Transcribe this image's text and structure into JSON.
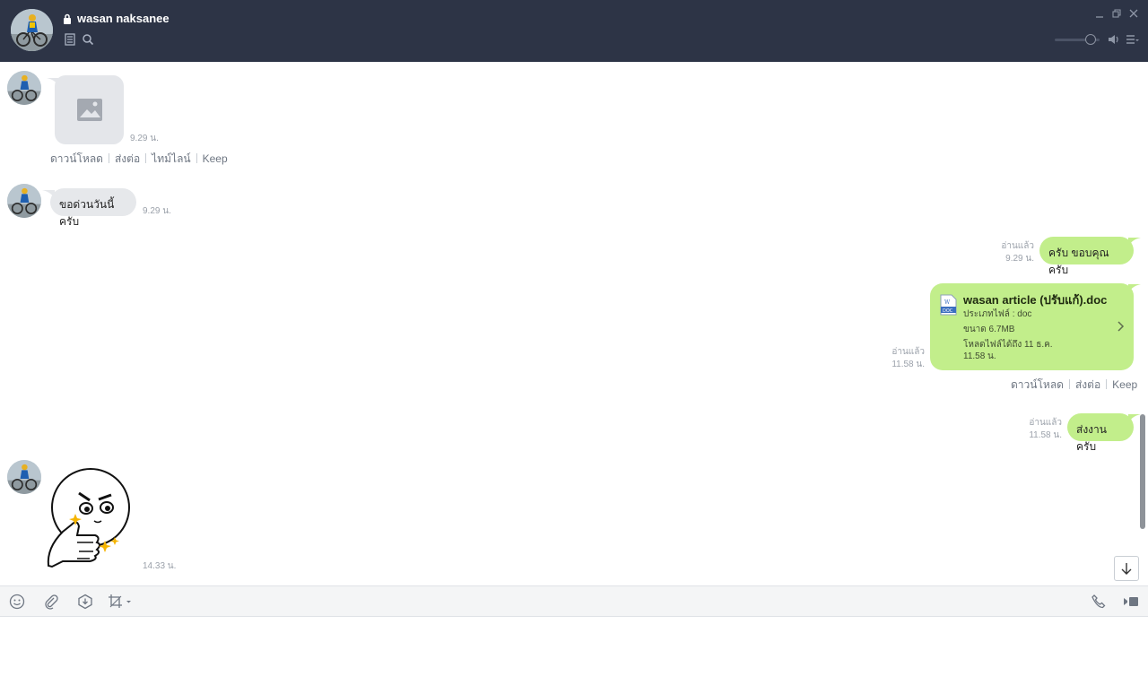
{
  "header": {
    "contact_name": "wasan naksanee",
    "icons": [
      "lock-icon",
      "notes-icon",
      "search-icon",
      "minimize-icon",
      "restore-icon",
      "close-icon",
      "volume-icon",
      "menu-icon"
    ],
    "volume_level": 0.85
  },
  "messages": {
    "m1": {
      "type": "image",
      "time": "9.29 น.",
      "actions": [
        "ดาวน์โหลด",
        "ส่งต่อ",
        "ไทม์ไลน์",
        "Keep"
      ]
    },
    "m2": {
      "text": "ขอด่วนวันนี้ครับ",
      "time": "9.29 น."
    },
    "m3": {
      "text": "ครับ ขอบคุณครับ",
      "read": "อ่านแล้ว",
      "time": "9.29 น."
    },
    "m4": {
      "file_name": "wasan article (ปรับแก้).doc",
      "file_type": "ประเภทไฟล์ : doc",
      "file_size": "ขนาด 6.7MB",
      "expiry": "โหลดไฟล์ได้ถึง 11 ธ.ค.",
      "expiry_time": "11.58 น.",
      "read": "อ่านแล้ว",
      "time": "11.58 น.",
      "actions": [
        "ดาวน์โหลด",
        "ส่งต่อ",
        "Keep"
      ]
    },
    "m5": {
      "text": "ส่งงานครับ",
      "read": "อ่านแล้ว",
      "time": "11.58 น."
    },
    "m6": {
      "type": "sticker",
      "time": "14.33 น."
    }
  },
  "toolbar": {
    "left_icons": [
      "emoji-icon",
      "attach-icon",
      "keep-icon",
      "screenshot-icon"
    ],
    "right_icons": [
      "call-icon",
      "video-call-icon"
    ]
  },
  "colors": {
    "header_bg": "#2d3446",
    "bubble_out": "#c2ee8b",
    "bubble_in": "#e6e8eb"
  }
}
